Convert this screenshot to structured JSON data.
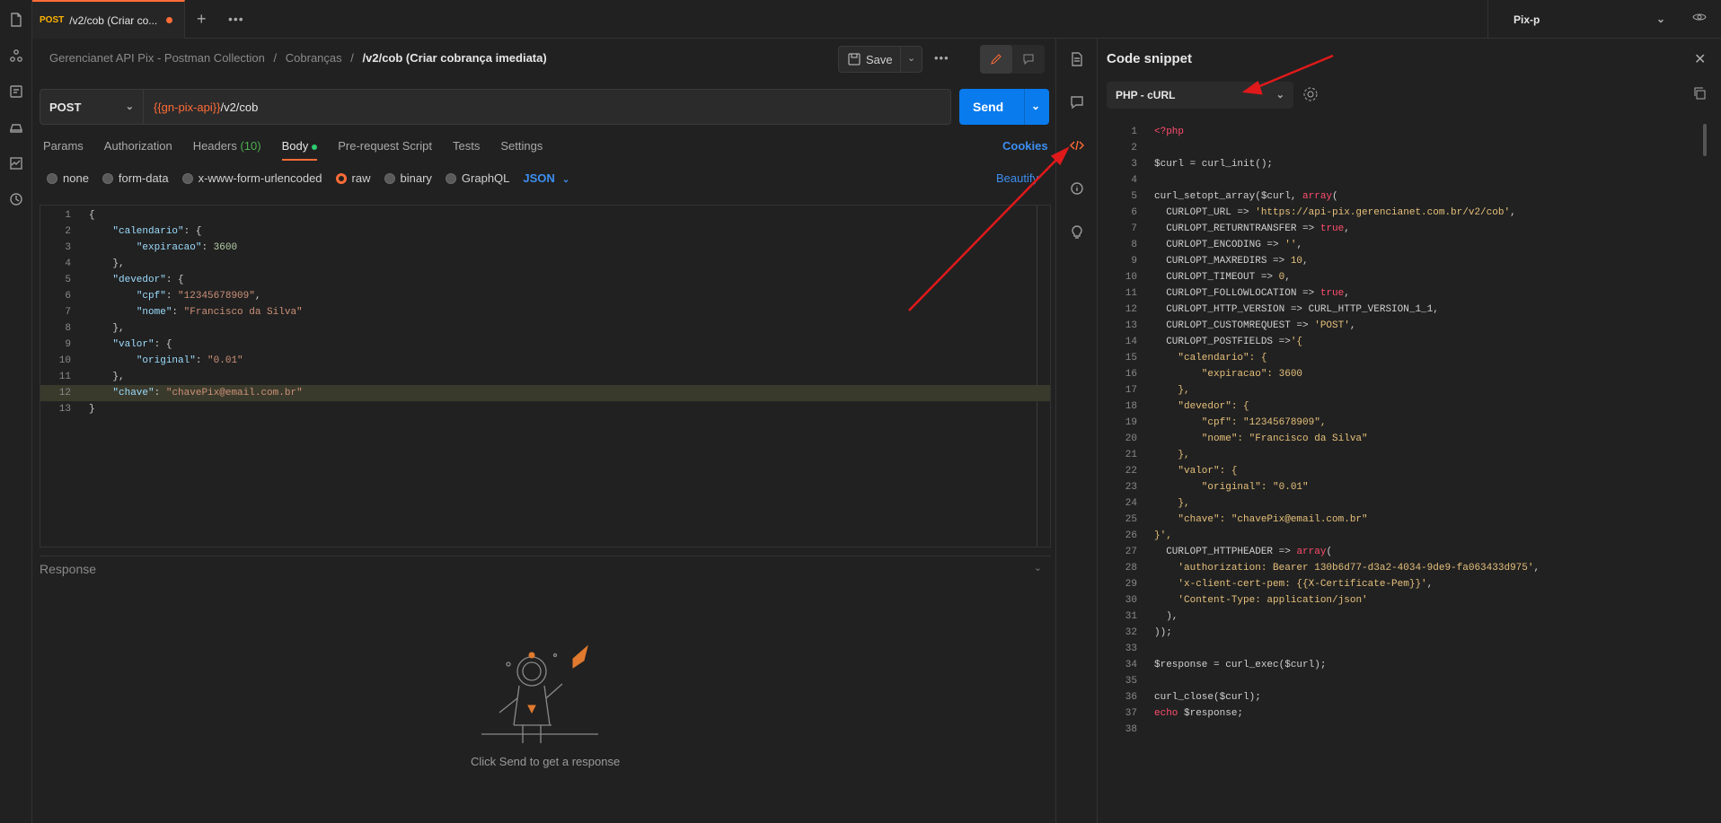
{
  "tabbar": {
    "tab_method": "POST",
    "tab_title": "/v2/cob (Criar co...",
    "environment": "Pix-p"
  },
  "breadcrumb": {
    "collection": "Gerencianet API Pix - Postman Collection",
    "folder": "Cobranças",
    "request": "/v2/cob (Criar cobrança imediata)",
    "sep": "/"
  },
  "toolbar": {
    "save_label": "Save"
  },
  "request": {
    "method": "POST",
    "url_var": "{{gn-pix-api}}",
    "url_path": "/v2/cob",
    "send_label": "Send"
  },
  "req_tabs": [
    {
      "label": "Params"
    },
    {
      "label": "Authorization"
    },
    {
      "label": "Headers",
      "count": "(10)"
    },
    {
      "label": "Body"
    },
    {
      "label": "Pre-request Script"
    },
    {
      "label": "Tests"
    },
    {
      "label": "Settings"
    }
  ],
  "cookies_label": "Cookies",
  "body_types": [
    "none",
    "form-data",
    "x-www-form-urlencoded",
    "raw",
    "binary",
    "GraphQL"
  ],
  "body_format": "JSON",
  "beautify_label": "Beautify",
  "body_lines": [
    "{",
    "    \"calendario\": {",
    "        \"expiracao\": 3600",
    "    },",
    "    \"devedor\": {",
    "        \"cpf\": \"12345678909\",",
    "        \"nome\": \"Francisco da Silva\"",
    "    },",
    "    \"valor\": {",
    "        \"original\": \"0.01\"",
    "    },",
    "    \"chave\": \"chavePix@email.com.br\"",
    "}"
  ],
  "response": {
    "title": "Response",
    "hint": "Click Send to get a response"
  },
  "snippet": {
    "title": "Code snippet",
    "language": "PHP - cURL",
    "lines": [
      "<?php",
      "",
      "$curl = curl_init();",
      "",
      "curl_setopt_array($curl, array(",
      "  CURLOPT_URL => 'https://api-pix.gerencianet.com.br/v2/cob',",
      "  CURLOPT_RETURNTRANSFER => true,",
      "  CURLOPT_ENCODING => '',",
      "  CURLOPT_MAXREDIRS => 10,",
      "  CURLOPT_TIMEOUT => 0,",
      "  CURLOPT_FOLLOWLOCATION => true,",
      "  CURLOPT_HTTP_VERSION => CURL_HTTP_VERSION_1_1,",
      "  CURLOPT_CUSTOMREQUEST => 'POST',",
      "  CURLOPT_POSTFIELDS =>'{",
      "    \"calendario\": {",
      "        \"expiracao\": 3600",
      "    },",
      "    \"devedor\": {",
      "        \"cpf\": \"12345678909\",",
      "        \"nome\": \"Francisco da Silva\"",
      "    },",
      "    \"valor\": {",
      "        \"original\": \"0.01\"",
      "    },",
      "    \"chave\": \"chavePix@email.com.br\"",
      "}',",
      "  CURLOPT_HTTPHEADER => array(",
      "    'authorization: Bearer 130b6d77-d3a2-4034-9de9-fa063433d975',",
      "    'x-client-cert-pem: {{X-Certificate-Pem}}',",
      "    'Content-Type: application/json'",
      "  ),",
      "));",
      "",
      "$response = curl_exec($curl);",
      "",
      "curl_close($curl);",
      "echo $response;",
      ""
    ]
  },
  "colors": {
    "accent": "#ff6c37",
    "send_blue": "#097bed",
    "link_blue": "#3d8ef0",
    "annotation_arrow": "#e0191b"
  }
}
